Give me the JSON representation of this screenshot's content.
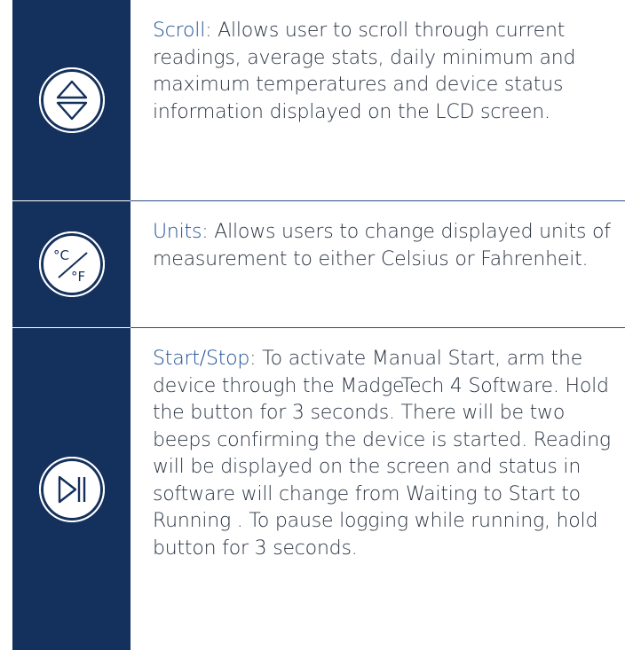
{
  "rows": [
    {
      "icon": "scroll-up-down-icon",
      "lead": "Scroll",
      "text": ": Allows user to scroll through current readings, average stats, daily minimum and maximum temperatures and device status information displayed on the LCD screen."
    },
    {
      "icon": "celsius-fahrenheit-icon",
      "lead": "Units",
      "text": ": Allows users to change displayed units of measurement to either Celsius or Fahrenheit.",
      "icon_glyph_top": "°C",
      "icon_glyph_bottom": "°F"
    },
    {
      "icon": "play-pause-icon",
      "lead": "Start/Stop",
      "text": ": To activate Manual Start, arm the device through the MadgeTech 4 Software. Hold the button for 3 seconds. There will be two beeps confirming the device is started.  Reading will be displayed on the screen and status in software will change from Waiting to Start to Running . To pause logging while running, hold button for 3 seconds."
    }
  ],
  "colors": {
    "icon_panel": "#14305c",
    "lead_text": "#1f4f94",
    "body_text": "#2a3342"
  }
}
